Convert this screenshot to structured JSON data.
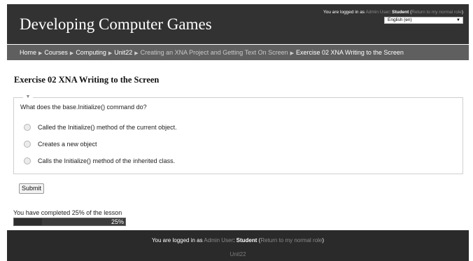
{
  "header": {
    "site_title": "Developing Computer Games",
    "login_prefix": "You are logged in as",
    "login_admin": "Admin User",
    "login_colon": ":",
    "login_role": "Student",
    "login_open": "(",
    "login_return": "Return to my normal role",
    "login_close": ")",
    "language": "English (en)"
  },
  "breadcrumb": {
    "items": [
      "Home",
      "Courses",
      "Computing",
      "Unit22",
      "Creating an XNA Project and Getting Text On Screen",
      "Exercise 02 XNA Writing to the Screen"
    ]
  },
  "main": {
    "heading": "Exercise 02 XNA Writing to the Screen",
    "question": "What does the base.Initialize() command do?",
    "options": [
      "Called the Initialize() method of the current object.",
      "Creates a new object",
      "Calls the Initialize() method of the inherited class."
    ],
    "submit_label": "Submit",
    "progress_text": "You have completed 25% of the lesson",
    "progress_label": "25%",
    "progress_fraction": 0.25
  },
  "footer": {
    "login_prefix": "You are logged in as",
    "login_admin": "Admin User",
    "login_colon": ":",
    "login_role": "Student",
    "login_open": "(",
    "login_return": "Return to my normal role",
    "login_close": ")",
    "course": "Unit22"
  },
  "icons": {
    "breadcrumb_separator": "triangle-right-icon",
    "collapse": "triangle-down-icon",
    "dropdown": "triangle-down-icon"
  },
  "colors": {
    "header_bg": "#323232",
    "navbar_bg": "#5f5f5f",
    "footer_bg": "#2a2a2a"
  }
}
